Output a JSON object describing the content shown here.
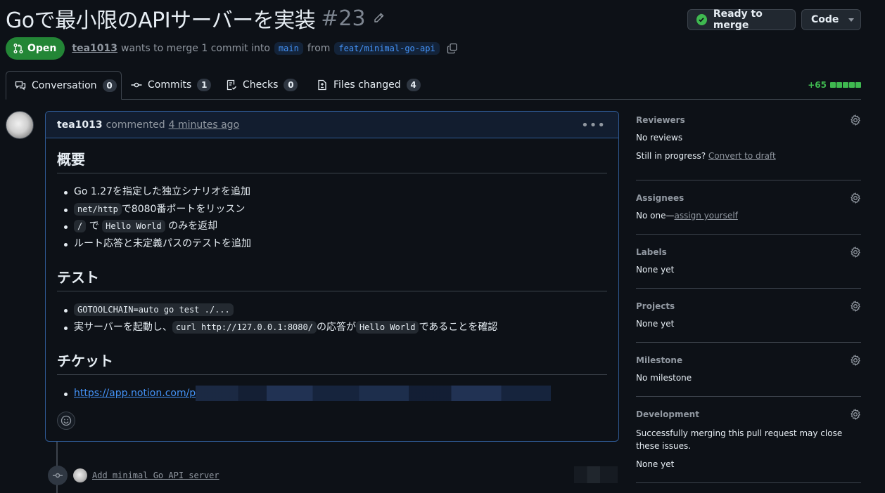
{
  "header": {
    "title": "Goで最小限のAPIサーバーを実装",
    "number": "#23",
    "ready_label": "Ready to merge",
    "code_label": "Code"
  },
  "meta": {
    "state": "Open",
    "author": "tea1013",
    "merge_text": "wants to merge 1 commit into",
    "base_branch": "main",
    "from_text": "from",
    "head_branch": "feat/minimal-go-api"
  },
  "tabs": [
    {
      "label": "Conversation",
      "count": "0"
    },
    {
      "label": "Commits",
      "count": "1"
    },
    {
      "label": "Checks",
      "count": "0"
    },
    {
      "label": "Files changed",
      "count": "4"
    }
  ],
  "diffstat": "+65",
  "comment": {
    "author": "tea1013",
    "action": "commented",
    "time": "4 minutes ago",
    "sections": {
      "overview": {
        "heading": "概要",
        "item1": "Go 1.27を指定した独立シナリオを追加",
        "item2_code": "net/http",
        "item2_text": "で8080番ポートをリッスン",
        "item3_code1": "/",
        "item3_text1": "で",
        "item3_code2": "Hello World",
        "item3_text2": "のみを返却",
        "item4": "ルート応答と未定義パスのテストを追加"
      },
      "test": {
        "heading": "テスト",
        "item1_code": "GOTOOLCHAIN=auto go test ./...",
        "item2_text1": "実サーバーを起動し、",
        "item2_code1": "curl http://127.0.0.1:8080/",
        "item2_text2": "の応答が",
        "item2_code2": "Hello World",
        "item2_text3": "であることを確認"
      },
      "ticket": {
        "heading": "チケット",
        "url": "https://app.notion.com/p"
      }
    }
  },
  "commit": {
    "message": "Add minimal Go API server"
  },
  "sidebar": {
    "reviewers": {
      "title": "Reviewers",
      "value": "No reviews",
      "progress_text": "Still in progress?",
      "progress_link": "Convert to draft"
    },
    "assignees": {
      "title": "Assignees",
      "value": "No one—",
      "link": "assign yourself"
    },
    "labels": {
      "title": "Labels",
      "value": "None yet"
    },
    "projects": {
      "title": "Projects",
      "value": "None yet"
    },
    "milestone": {
      "title": "Milestone",
      "value": "No milestone"
    },
    "development": {
      "title": "Development",
      "description": "Successfully merging this pull request may close these issues.",
      "value": "None yet"
    }
  },
  "colors": {
    "accent": "#4493f8",
    "success": "#238636",
    "background": "#0d1117"
  }
}
